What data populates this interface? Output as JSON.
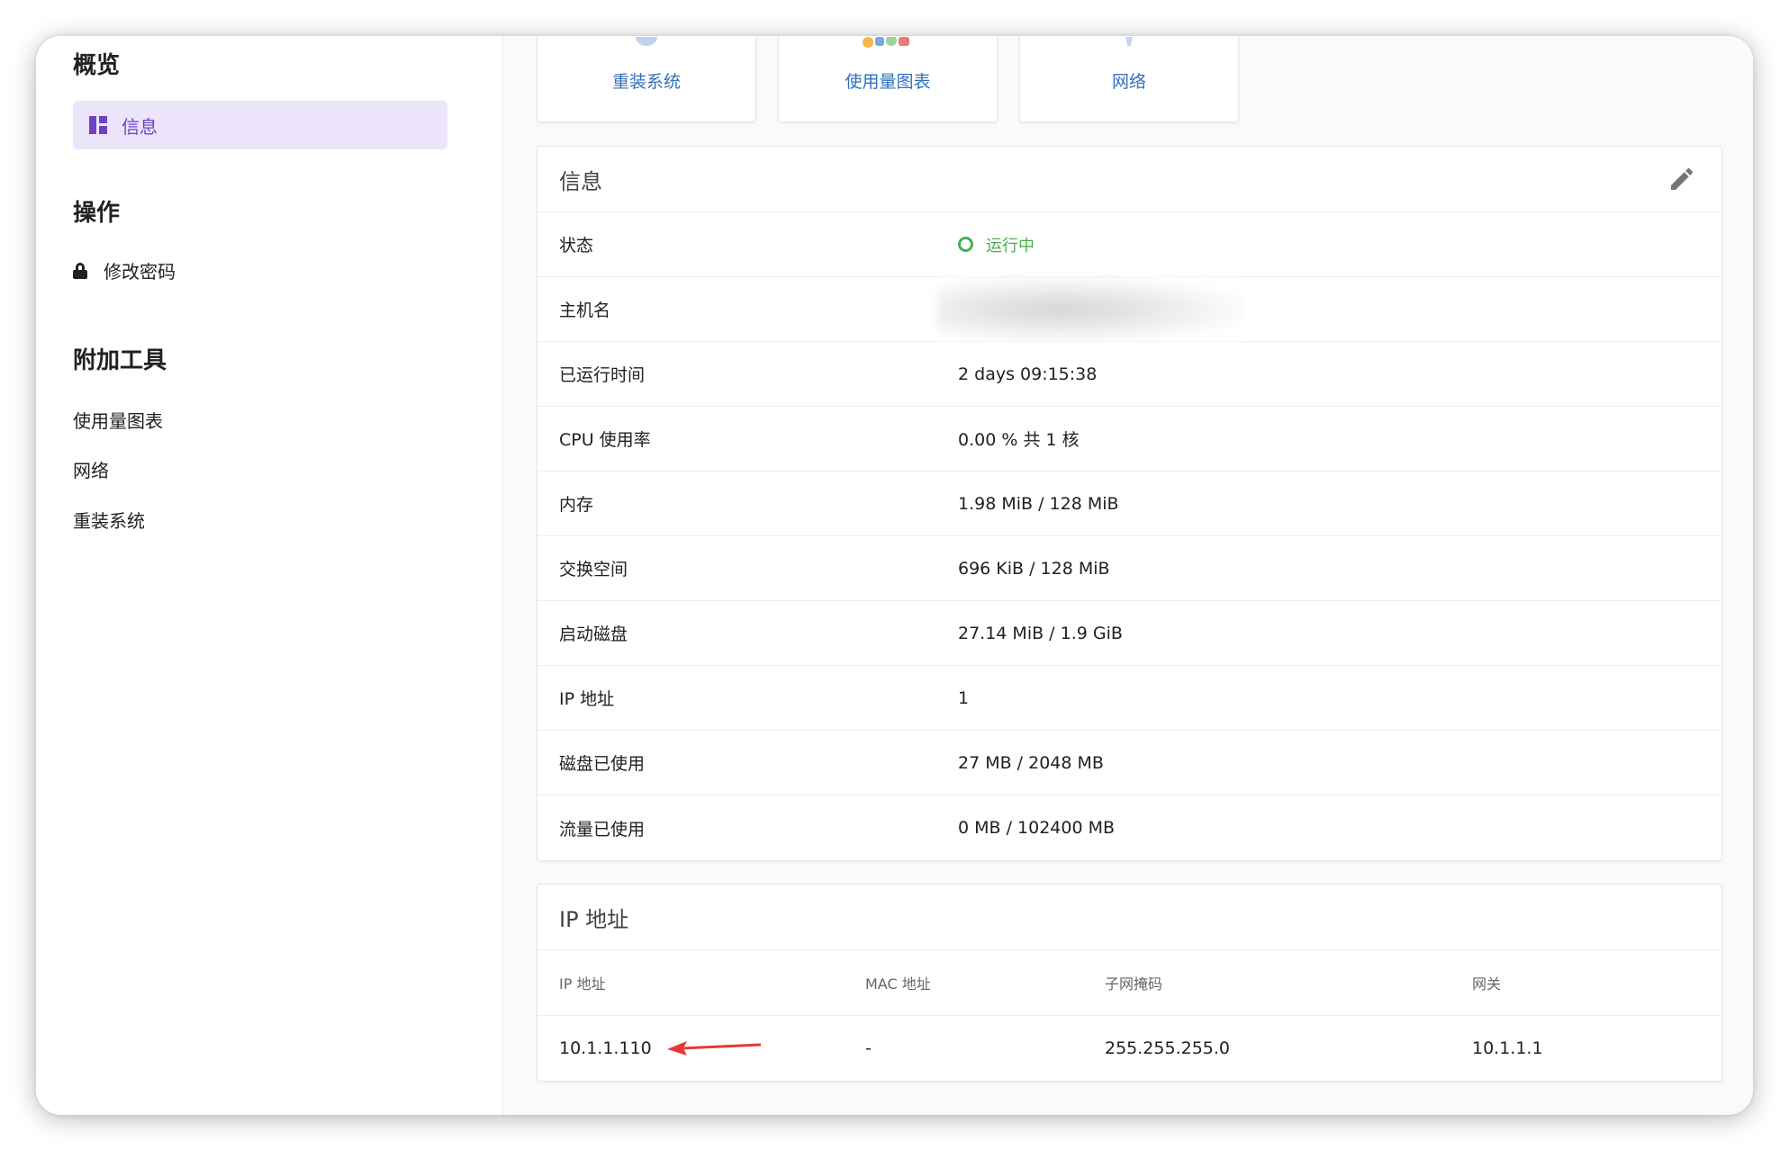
{
  "sidebar": {
    "overview_heading": "概览",
    "overview_items": [
      {
        "label": "信息",
        "icon": "dashboard-icon",
        "active": true
      }
    ],
    "actions_heading": "操作",
    "actions_items": [
      {
        "label": "修改密码",
        "icon": "lock-icon"
      }
    ],
    "tools_heading": "附加工具",
    "tools_items": [
      {
        "label": "使用量图表"
      },
      {
        "label": "网络"
      },
      {
        "label": "重装系统"
      }
    ]
  },
  "quick_links": [
    {
      "label": "重装系统",
      "icon": "reinstall-icon"
    },
    {
      "label": "使用量图表",
      "icon": "chart-icon"
    },
    {
      "label": "网络",
      "icon": "network-icon"
    }
  ],
  "info_panel": {
    "title": "信息",
    "edit_icon": "pencil-icon",
    "rows": [
      {
        "key": "状态",
        "value": "运行中",
        "status_color": "#4caf50"
      },
      {
        "key": "主机名",
        "value": ""
      },
      {
        "key": "已运行时间",
        "value": "2 days 09:15:38"
      },
      {
        "key": "CPU 使用率",
        "value": "0.00 % 共 1 核"
      },
      {
        "key": "内存",
        "value": "1.98 MiB / 128 MiB"
      },
      {
        "key": "交换空间",
        "value": "696 KiB / 128 MiB"
      },
      {
        "key": "启动磁盘",
        "value": "27.14 MiB / 1.9 GiB"
      },
      {
        "key": "IP 地址",
        "value": "1"
      },
      {
        "key": "磁盘已使用",
        "value": "27 MB / 2048 MB"
      },
      {
        "key": "流量已使用",
        "value": "0 MB / 102400 MB"
      }
    ]
  },
  "ip_panel": {
    "title": "IP 地址",
    "columns": [
      "IP 地址",
      "MAC 地址",
      "子网掩码",
      "网关"
    ],
    "rows": [
      {
        "ip": "10.1.1.110",
        "mac": "-",
        "netmask": "255.255.255.0",
        "gateway": "10.1.1.1"
      }
    ]
  },
  "colors": {
    "accent": "#6f42c1",
    "link": "#2f72b8",
    "status_running": "#4caf50",
    "annotation_arrow": "#e53935"
  }
}
